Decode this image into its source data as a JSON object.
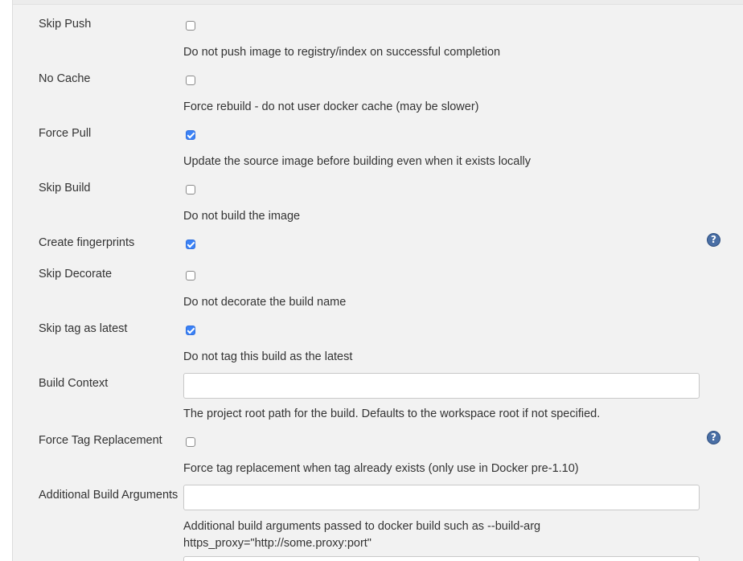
{
  "fields": {
    "skip_push": {
      "label": "Skip Push",
      "checked": false,
      "description": "Do not push image to registry/index on successful completion"
    },
    "no_cache": {
      "label": "No Cache",
      "checked": false,
      "description": "Force rebuild - do not user docker cache (may be slower)"
    },
    "force_pull": {
      "label": "Force Pull",
      "checked": true,
      "description": "Update the source image before building even when it exists locally"
    },
    "skip_build": {
      "label": "Skip Build",
      "checked": false,
      "description": "Do not build the image"
    },
    "create_fingerprints": {
      "label": "Create fingerprints",
      "checked": true
    },
    "skip_decorate": {
      "label": "Skip Decorate",
      "checked": false,
      "description": "Do not decorate the build name"
    },
    "skip_tag_latest": {
      "label": "Skip tag as latest",
      "checked": true,
      "description": "Do not tag this build as the latest"
    },
    "build_context": {
      "label": "Build Context",
      "value": "",
      "description": "The project root path for the build. Defaults to the workspace root if not specified."
    },
    "force_tag_replacement": {
      "label": "Force Tag Replacement",
      "checked": false,
      "description": "Force tag replacement when tag already exists (only use in Docker pre-1.10)"
    },
    "additional_build_arguments": {
      "label": "Additional Build Arguments",
      "value": "",
      "description_line1": "Additional build arguments passed to docker build such as --build-arg",
      "description_line2": "https_proxy=\"http://some.proxy:port\""
    }
  },
  "help_icon": {
    "glyph": "?",
    "color": "#4a6fa5"
  },
  "colors": {
    "checkbox_checked": "#3b82f6",
    "panel_bg": "#f2f2f2"
  }
}
